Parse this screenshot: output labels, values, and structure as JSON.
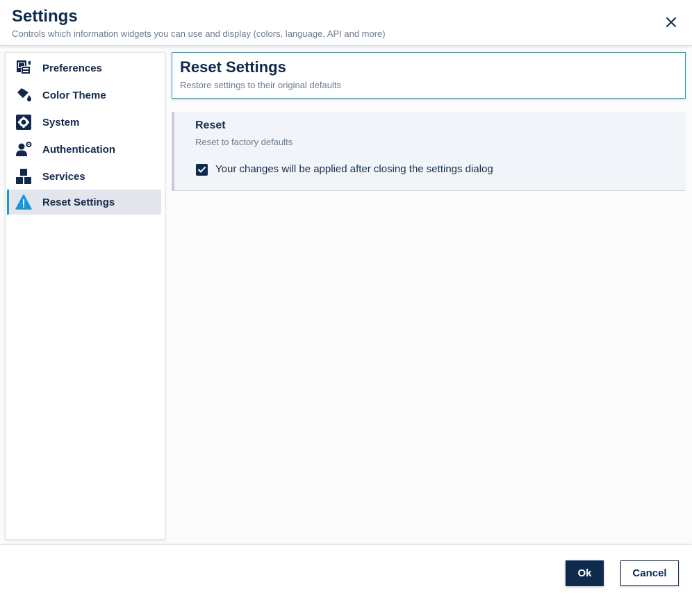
{
  "dialog": {
    "title": "Settings",
    "subtitle": "Controls which information widgets you can use and display (colors, language, API and more)",
    "close_icon": "close-icon"
  },
  "sidebar": {
    "items": [
      {
        "label": "Preferences",
        "icon": "preferences-icon",
        "active": false
      },
      {
        "label": "Color Theme",
        "icon": "paint-bucket-icon",
        "active": false
      },
      {
        "label": "System",
        "icon": "gear-icon",
        "active": false
      },
      {
        "label": "Authentication",
        "icon": "user-gear-icon",
        "active": false
      },
      {
        "label": "Services",
        "icon": "cubes-icon",
        "active": false
      },
      {
        "label": "Reset Settings",
        "icon": "warning-icon",
        "active": true
      }
    ]
  },
  "main": {
    "title": "Reset Settings",
    "subtitle": "Restore settings to their original defaults",
    "reset_section": {
      "title": "Reset",
      "subtitle": "Reset to factory defaults",
      "checkbox_checked": true,
      "checkbox_label": "Your changes will be applied after closing the settings dialog"
    }
  },
  "footer": {
    "ok_label": "Ok",
    "cancel_label": "Cancel"
  },
  "colors": {
    "primary": "#0e2a4d",
    "accent": "#1996d8",
    "warning_icon": "#1996d8"
  }
}
